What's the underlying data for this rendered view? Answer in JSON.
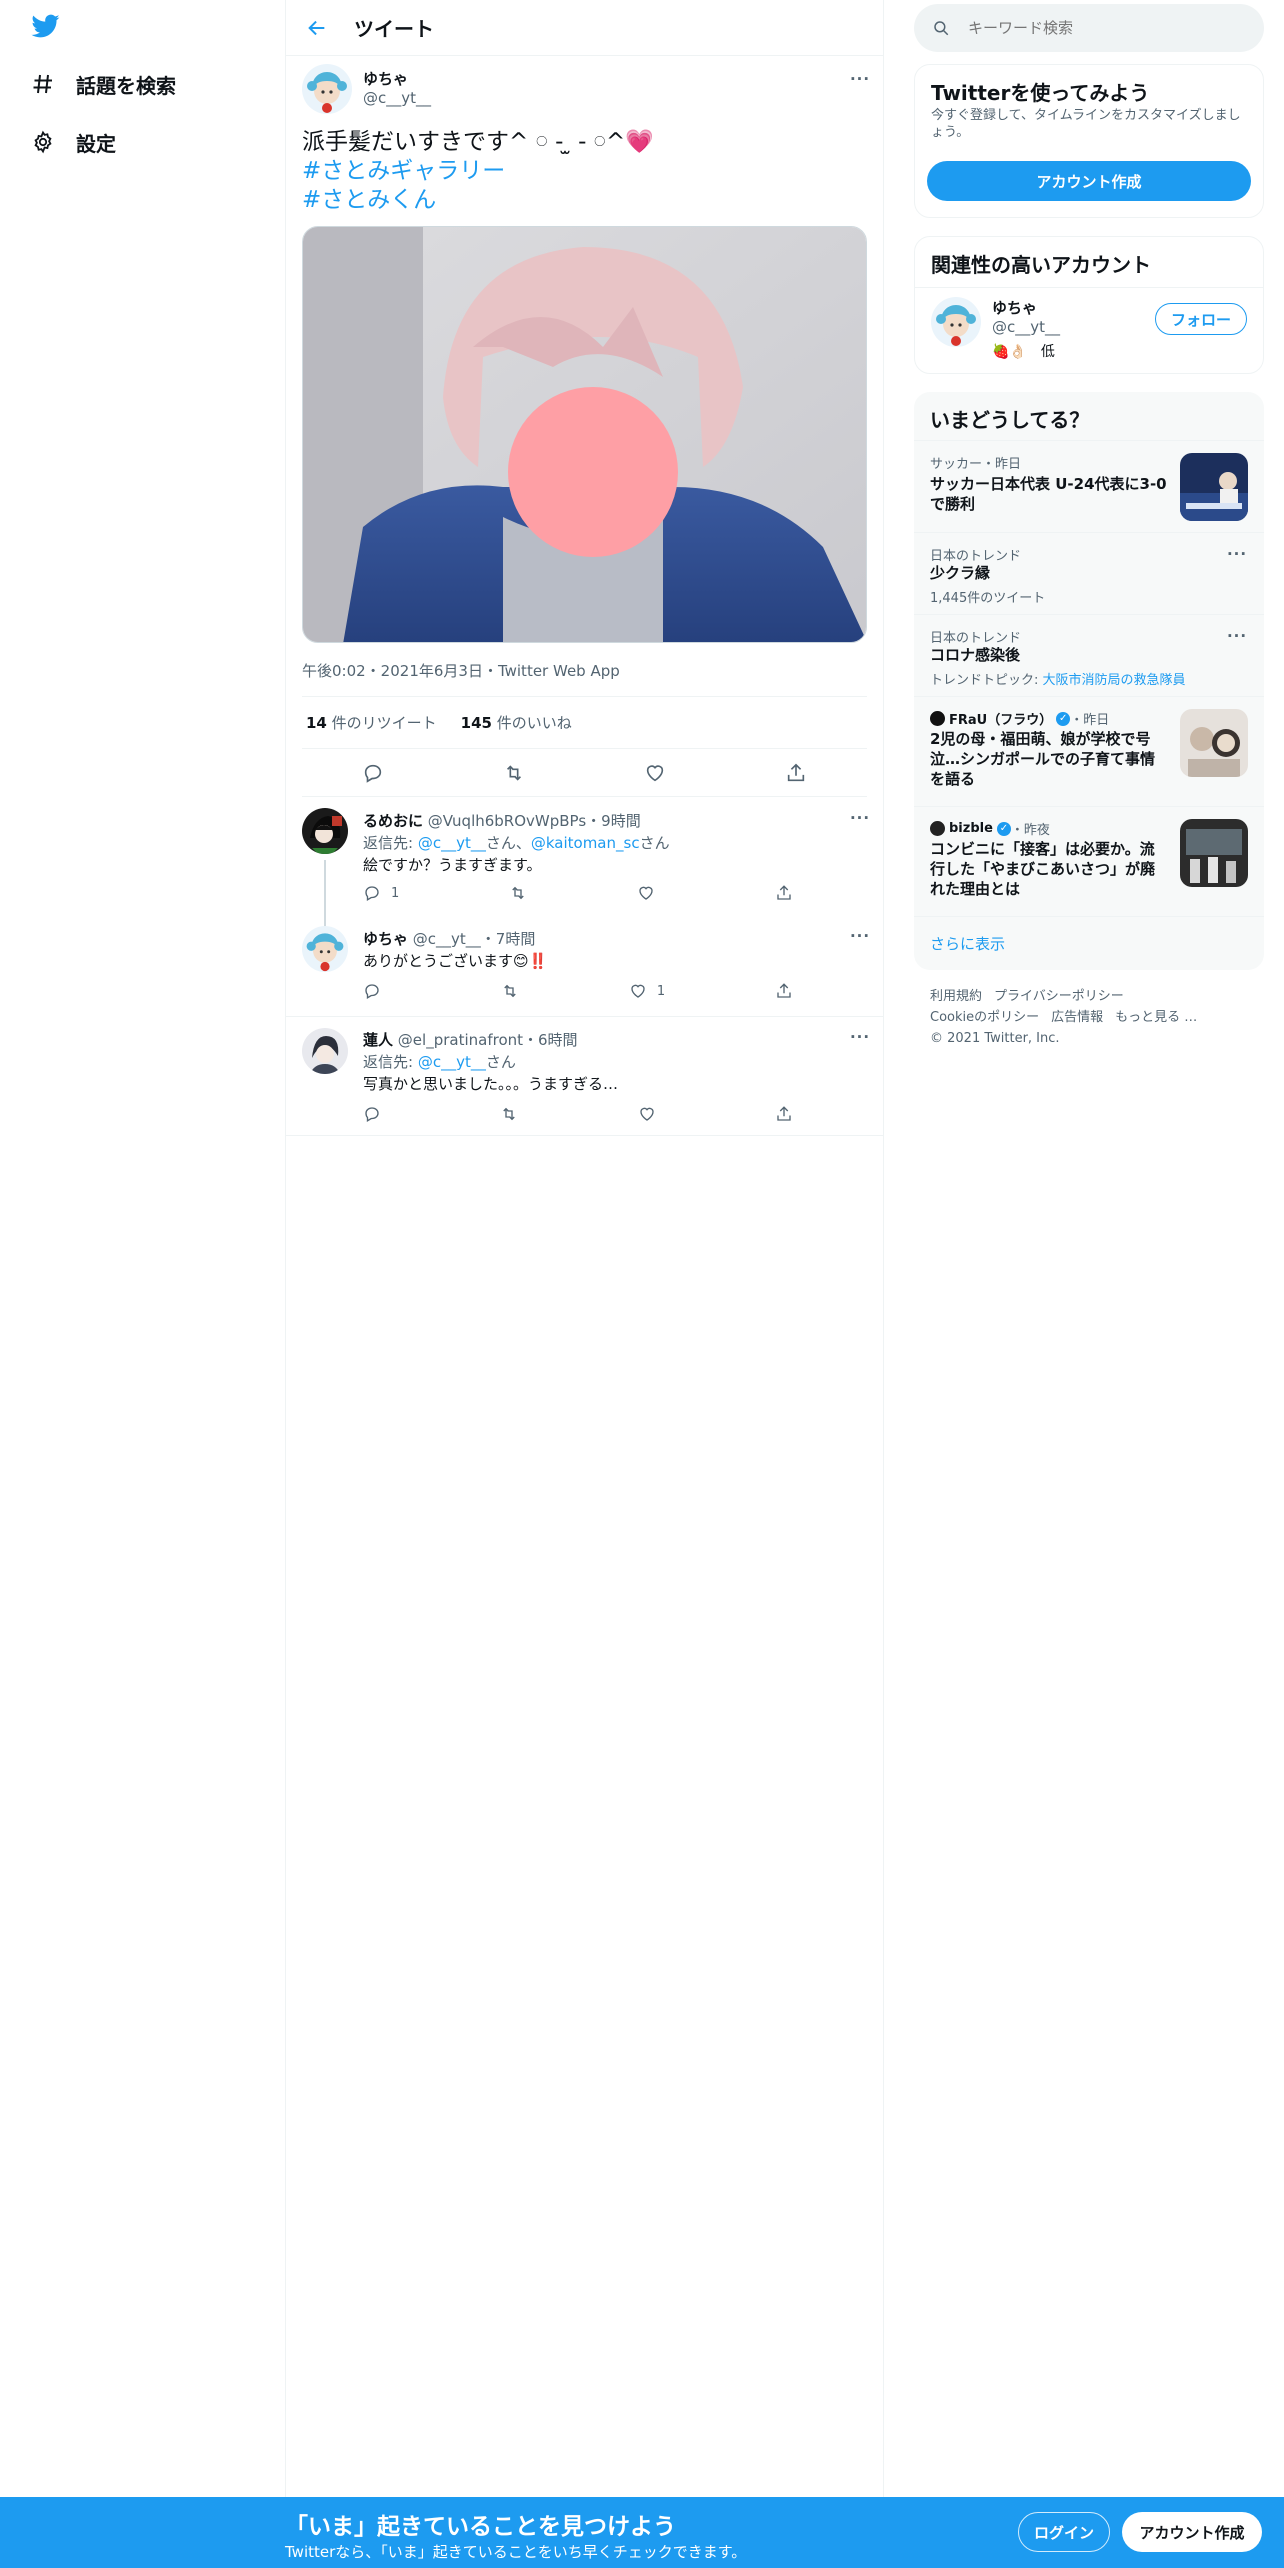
{
  "nav": {
    "explore_label": "話題を検索",
    "settings_label": "設定"
  },
  "header": {
    "title": "ツイート"
  },
  "tweet": {
    "author_name": "ゆちゃ",
    "author_handle": "@c__yt__",
    "text": "派手髪だいすきです^ 𓏸 - ̫ - 𓏸^",
    "heart_emoji": "💗",
    "hashtags": [
      "#さとみギャラリー",
      "#さとみくん"
    ],
    "meta": "午後0:02・2021年6月3日・Twitter Web App",
    "retweet_count": "14",
    "retweet_label": " 件のリツイート",
    "like_count": "145",
    "like_label": " 件のいいね"
  },
  "replies": [
    {
      "name": "るめおに",
      "handle_time": "@Vuqlh6bROvWpBPs・9時間",
      "reply_to_prefix": "返信先: ",
      "reply_to_1": "@c__yt__",
      "reply_to_mid": "さん、",
      "reply_to_2": "@kaitoman_sc",
      "reply_to_suffix": "さん",
      "body": "絵ですか？うますぎます。",
      "reply_count": "1",
      "like_count": ""
    },
    {
      "name": "ゆちゃ",
      "handle_time": "@c__yt__・7時間",
      "body": "ありがとうございます😊‼️",
      "reply_count": "",
      "like_count": "1"
    },
    {
      "name": "蓮人",
      "handle_time": "@el_pratinafront・6時間",
      "reply_to_prefix": "返信先: ",
      "reply_to_1": "@c__yt__",
      "reply_to_suffix": "さん",
      "body": "写真かと思いました。。。うますぎる…",
      "reply_count": "",
      "like_count": ""
    }
  ],
  "search": {
    "placeholder": "キーワード検索"
  },
  "signup_card": {
    "title": "Twitterを使ってみよう",
    "subtitle": "今すぐ登録して、タイムラインをカスタマイズしましょう。",
    "button": "アカウント作成"
  },
  "related_card": {
    "title": "関連性の高いアカウント",
    "name": "ゆちゃ",
    "handle": "@c__yt__",
    "bio": "🍓👌🏻　低",
    "follow_button": "フォロー"
  },
  "trends": {
    "title": "いまどうしてる？",
    "items": [
      {
        "category": "サッカー・昨日",
        "title": "サッカー日本代表 U-24代表に3-0で勝利"
      },
      {
        "category": "日本のトレンド",
        "title": "少クラ縁",
        "count": "1,445件のツイート"
      },
      {
        "category": "日本のトレンド",
        "title": "コロナ感染後",
        "topic_prefix": "トレンドトピック: ",
        "topic": "大阪市消防局の救急隊員"
      },
      {
        "category": "FRaU（フラウ）",
        "time": "・昨日",
        "title": "2児の母・福田萌、娘が学校で号泣…シンガポールでの子育て事情を語る"
      },
      {
        "category": "bizble",
        "time": "・昨夜",
        "title": "コンビニに「接客」は必要か。流行した「やまびこあいさつ」が廃れた理由とは"
      }
    ],
    "show_more": "さらに表示"
  },
  "footer": {
    "terms": "利用規約",
    "privacy": "プライバシーポリシー",
    "cookie": "Cookieのポリシー",
    "ads": "広告情報",
    "more": "もっと見る …",
    "copyright": "© 2021 Twitter, Inc."
  },
  "bottom_bar": {
    "title": "「いま」起きていることを見つけよう",
    "subtitle": "Twitterなら、「いま」起きていることをいち早くチェックできます。",
    "login": "ログイン",
    "signup": "アカウント作成"
  },
  "colors": {
    "accent": "#1d9bf0",
    "text": "#0f1419",
    "muted": "#536471"
  }
}
